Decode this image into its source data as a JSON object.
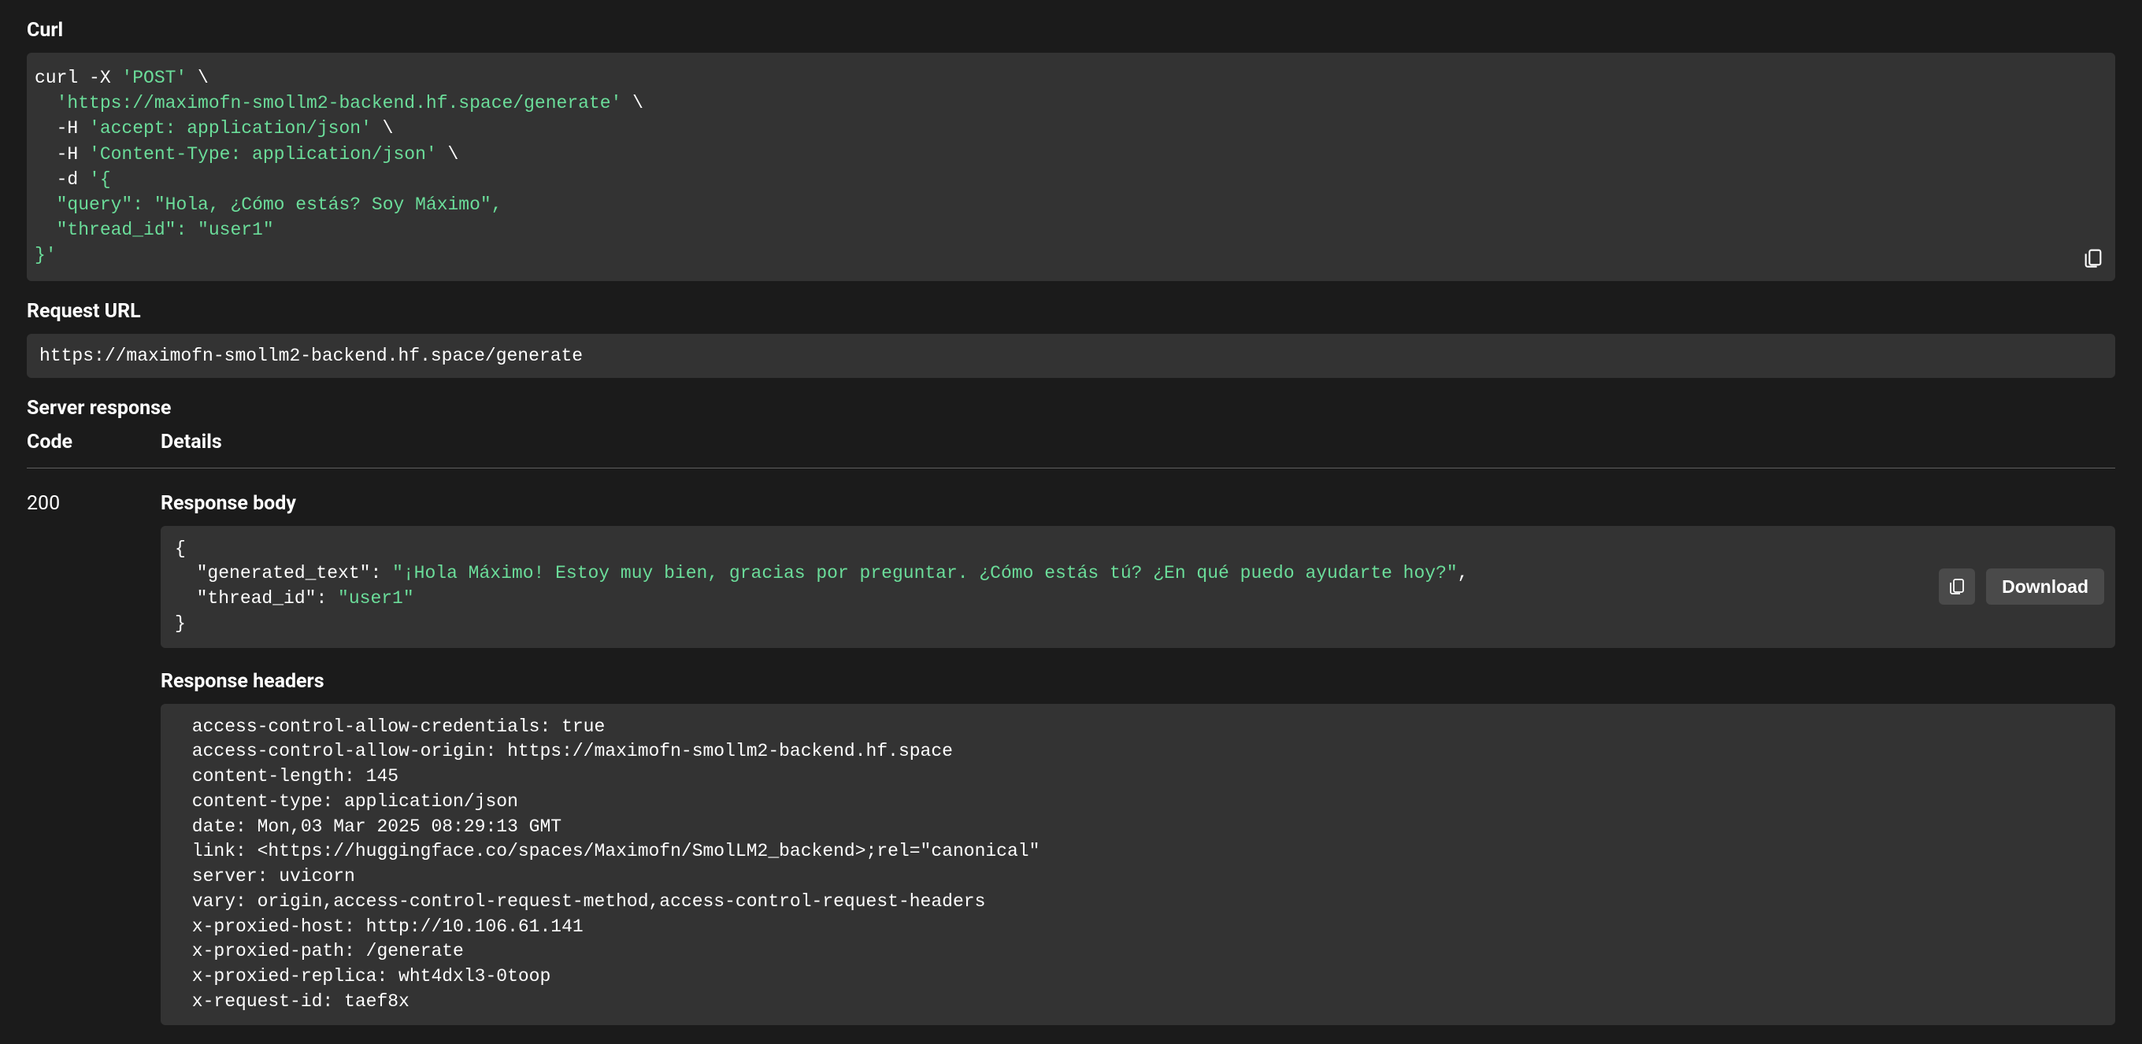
{
  "curl": {
    "label": "Curl",
    "method_flag": "curl -X ",
    "method": "'POST'",
    "bs": " \\",
    "url": "'https://maximofn-smollm2-backend.hf.space/generate'",
    "h_flag": "  -H ",
    "h_accept": "'accept: application/json'",
    "h_ctype": "'Content-Type: application/json'",
    "d_flag": "  -d ",
    "d_open": "'{",
    "body_k1": "  \"query\"",
    "body_v1": "\"Hola, ¿Cómo estás? Soy Máximo\"",
    "body_k2": "  \"thread_id\"",
    "body_v2": "\"user1\"",
    "d_close": "}'"
  },
  "request_url": {
    "label": "Request URL",
    "value": "https://maximofn-smollm2-backend.hf.space/generate"
  },
  "server_response": {
    "label": "Server response",
    "code_header": "Code",
    "details_header": "Details",
    "status_code": "200",
    "body_label": "Response body",
    "body_json": {
      "open": "{",
      "k1": "  \"generated_text\"",
      "v1": "\"¡Hola Máximo! Estoy muy bien, gracias por preguntar. ¿Cómo estás tú? ¿En qué puedo ayudarte hoy?\"",
      "k2": "  \"thread_id\"",
      "v2": "\"user1\"",
      "close": "}"
    },
    "download_label": "Download",
    "headers_label": "Response headers",
    "headers": [
      {
        "k": " access-control-allow-credentials: ",
        "v": "true "
      },
      {
        "k": " access-control-allow-origin: ",
        "v": "https://maximofn-smollm2-backend.hf.space "
      },
      {
        "k": " content-length: ",
        "v": "145 "
      },
      {
        "k": " content-type: ",
        "v": "application/json "
      },
      {
        "k": " date: ",
        "v": "Mon,03 Mar 2025 08:29:13 GMT "
      },
      {
        "k": " link: ",
        "v": "<https://huggingface.co/spaces/Maximofn/SmolLM2_backend>;rel=\"canonical\" "
      },
      {
        "k": " server: ",
        "v": "uvicorn "
      },
      {
        "k": " vary: ",
        "v": "origin,access-control-request-method,access-control-request-headers "
      },
      {
        "k": " x-proxied-host: ",
        "v": "http://10.106.61.141 "
      },
      {
        "k": " x-proxied-path: ",
        "v": "/generate "
      },
      {
        "k": " x-proxied-replica: ",
        "v": "wht4dxl3-0toop "
      },
      {
        "k": " x-request-id: ",
        "v": "taef8x "
      }
    ]
  }
}
